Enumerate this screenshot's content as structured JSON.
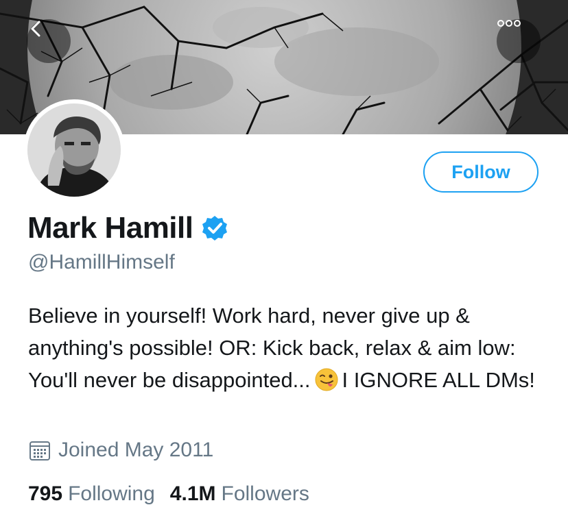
{
  "profile": {
    "name": "Mark Hamill",
    "handle": "@HamillHimself",
    "bio_text": "Believe in yourself! Work hard, never give up & anything's possible! OR: Kick back, relax & aim low: You'll never be disappointed...",
    "bio_emoji": "winking-face-with-tongue",
    "bio_tail": "I IGNORE ALL DMs!",
    "joined": "Joined May 2011",
    "verified": true
  },
  "actions": {
    "follow_label": "Follow",
    "back_icon": "chevron-left-icon",
    "more_icon": "more-dots-icon"
  },
  "stats": {
    "following_count": "795",
    "following_label": "Following",
    "followers_count": "4.1M",
    "followers_label": "Followers"
  },
  "colors": {
    "accent": "#1da1f2",
    "secondary_text": "#657786",
    "primary_text": "#14171a"
  }
}
